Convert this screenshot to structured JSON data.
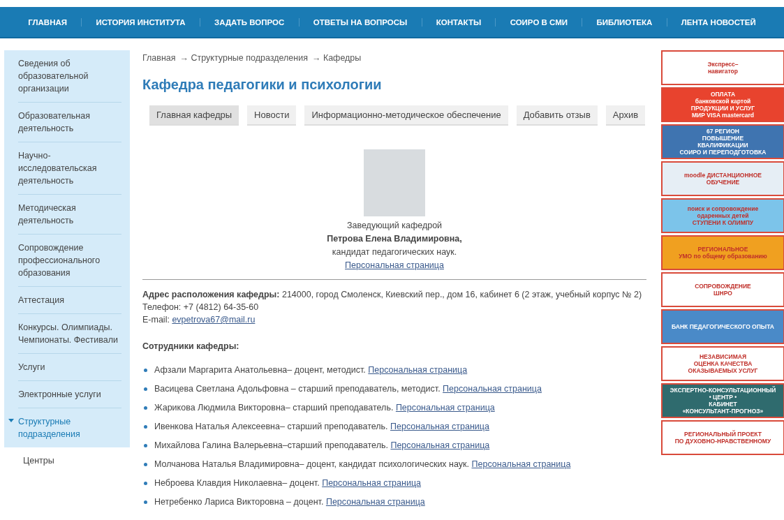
{
  "nav": [
    {
      "label": "ГЛАВНАЯ"
    },
    {
      "label": "ИСТОРИЯ ИНСТИТУТА"
    },
    {
      "label": "ЗАДАТЬ ВОПРОС"
    },
    {
      "label": "ОТВЕТЫ НА ВОПРОСЫ"
    },
    {
      "label": "КОНТАКТЫ"
    },
    {
      "label": "СОИРО В СМИ"
    },
    {
      "label": "БИБЛИОТЕКА"
    },
    {
      "label": "ЛЕНТА НОВОСТЕЙ"
    }
  ],
  "sidebar": {
    "items": [
      {
        "label": "Сведения об образовательной организации",
        "selected": false
      },
      {
        "label": "Образовательная деятельность",
        "selected": false
      },
      {
        "label": "Научно-исследовательская деятельность",
        "selected": false
      },
      {
        "label": "Методическая деятельность",
        "selected": false
      },
      {
        "label": "Сопровождение профессионального образования",
        "selected": false
      },
      {
        "label": "Аттестация",
        "selected": false
      },
      {
        "label": "Конкурсы. Олимпиады. Чемпионаты. Фестивали",
        "selected": false
      },
      {
        "label": "Услуги",
        "selected": false
      },
      {
        "label": "Электронные услуги",
        "selected": false
      },
      {
        "label": "Структурные подразделения",
        "selected": true,
        "expanded": true,
        "children": [
          {
            "label": "Центры",
            "selected": false
          }
        ]
      }
    ]
  },
  "breadcrumbs": [
    "Главная",
    "→ Структурные подразделения",
    "→ Кафедры"
  ],
  "title": "Кафедра педагогики и психологии",
  "tabs": [
    {
      "label": "Главная кафедры",
      "selected": true
    },
    {
      "label": "Новости",
      "selected": false
    },
    {
      "label": "Информационно-методическое обеспечение",
      "selected": false
    },
    {
      "label": "Добавить отзыв",
      "selected": false
    },
    {
      "label": "Архив",
      "selected": false
    }
  ],
  "head": {
    "role": "Заведующий кафедрой",
    "name": "Петрова Елена Владимировна,",
    "degree": "кандидат педагогических наук.",
    "link": "Персональная страница"
  },
  "contacts": {
    "address": "**Адрес расположения кафедры:** 214000, город Смоленск, Киевский пер., дом 16, кабинет 6 (2 этаж, учебный корпус № 2)",
    "phone": "Телефон: +7 (4812) 64-35-60",
    "email_label": "E-mail:",
    "email": "evpetrova67@mail.ru"
  },
  "staff_heading": "Сотрудники кафедры:",
  "staff": [
    {
      "text": "Афзали Маргарита Анатольевна– доцент, методист.",
      "link": "Персональная страница"
    },
    {
      "text": "Васицева Светлана Адольфовна – старший преподаватель, методист.",
      "link": "Персональная страница"
    },
    {
      "text": "Жарикова Людмила Викторовна– старший преподаватель.",
      "link": "Персональная страница"
    },
    {
      "text": "Ивенкова Наталья Алексеевна– старший преподаватель.",
      "link": "Персональная страница"
    },
    {
      "text": "Михайлова Галина Валерьевна–старший преподаватель.",
      "link": "Персональная страница"
    },
    {
      "text": "Молчанова Наталья Владимировна– доцент, кандидат психологических наук.",
      "link": "Персональная страница"
    },
    {
      "text": "Неброева Клавдия Николаевна– доцент.",
      "link": "Персональная страница"
    },
    {
      "text": "Нетребенко Лариса Викторовна – доцент.",
      "link": "Персональная страница"
    }
  ],
  "banners": [
    {
      "color": "#ffffff",
      "lines": [
        "Экспресс–",
        "навигатор"
      ]
    },
    {
      "color": "#e8432e",
      "lines": [
        "ОПЛАТА",
        "банковской картой",
        "ПРОДУКЦИИ И УСЛУГ",
        "МИР VISA mastercard"
      ]
    },
    {
      "color": "#3f74b0",
      "lines": [
        "67 РЕГИОН",
        "ПОВЫШЕНИЕ",
        "КВАЛИФИКАЦИИ",
        "СОИРО И ПЕРЕПОДГОТОВКА"
      ]
    },
    {
      "color": "#e6eef5",
      "lines": [
        "moodle ДИСТАНЦИОННОЕ",
        "ОБУЧЕНИЕ"
      ]
    },
    {
      "color": "#7cc4ea",
      "lines": [
        "поиск и сопровождение",
        "одаренных детей",
        "СТУПЕНИ К ОЛИМПУ"
      ]
    },
    {
      "color": "#f0a020",
      "lines": [
        "РЕГИОНАЛЬНОЕ",
        "УМО по общему образованию"
      ]
    },
    {
      "color": "#ffffff",
      "lines": [
        "СОПРОВОЖДЕНИЕ",
        "ШНРО"
      ]
    },
    {
      "color": "#4a8ac8",
      "lines": [
        "БАНК ПЕДАГОГИЧЕСКОГО ОПЫТА"
      ]
    },
    {
      "color": "#ffffff",
      "lines": [
        "НЕЗАВИСИМАЯ",
        "ОЦЕНКА КАЧЕСТВА",
        "ОКАЗЫВАЕМЫХ УСЛУГ"
      ]
    },
    {
      "color": "#2f6b6e",
      "lines": [
        "ЭКСПЕРТНО-КОНСУЛЬТАЦИОННЫЙ",
        "• ЦЕНТР •",
        "КАБИНЕТ",
        "«КОНСУЛЬТАНТ-ПРОГНОЗ»"
      ]
    },
    {
      "color": "#ffffff",
      "lines": [
        "РЕГИОНАЛЬНЫЙ ПРОЕКТ",
        "ПО ДУХОВНО-НРАВСТВЕННОМУ"
      ]
    }
  ]
}
